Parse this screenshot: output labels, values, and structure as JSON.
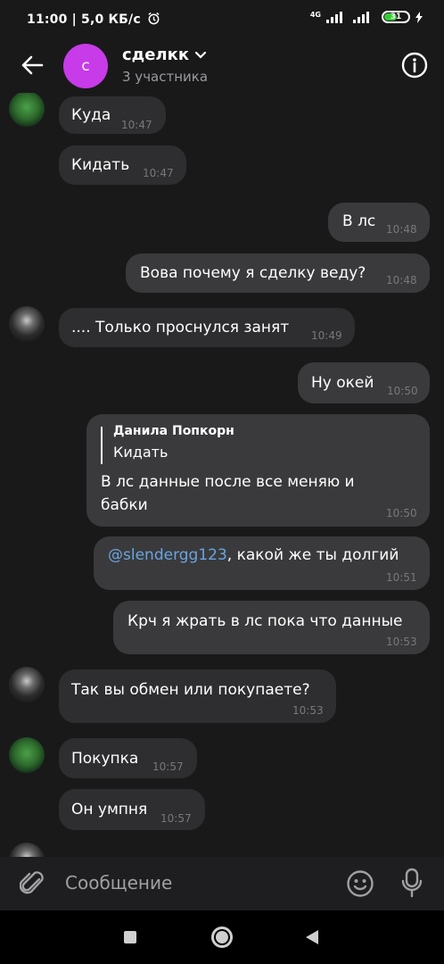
{
  "status_bar": {
    "time": "11:00",
    "speed": "5,0 КБ/с",
    "network": "4G",
    "battery": "31"
  },
  "header": {
    "avatar_letter": "с",
    "title": "сделкк",
    "subtitle": "3 участника"
  },
  "messages": [
    {
      "dir": "in",
      "text": "Куда",
      "time": "10:47",
      "avatar": "green"
    },
    {
      "dir": "in",
      "text": "Кидать",
      "time": "10:47"
    },
    {
      "dir": "out",
      "text": "В лс",
      "time": "10:48"
    },
    {
      "dir": "out",
      "text": "Вова почему я сделку веду?",
      "time": "10:48"
    },
    {
      "dir": "in",
      "text": ".... Только проснулся занят",
      "time": "10:49",
      "avatar": "dark"
    },
    {
      "dir": "out",
      "text": "Ну окей",
      "time": "10:50"
    },
    {
      "dir": "out",
      "reply_name": "Данила Попкорн",
      "reply_text": "Кидать",
      "line1": "В лс данные  после  все меняю и",
      "line2": "бабки",
      "time": "10:50"
    },
    {
      "dir": "out",
      "mention": "@slendergg123",
      "text": ",  какой же ты долгий",
      "time": "10:51"
    },
    {
      "dir": "out",
      "text": "Крч я жрать в лс пока что данные",
      "time": "10:53"
    },
    {
      "dir": "in",
      "text": "Так вы обмен или покупаете?",
      "time": "10:53",
      "avatar": "dark"
    },
    {
      "dir": "in",
      "text": "Покупка",
      "time": "10:57",
      "avatar": "green"
    },
    {
      "dir": "in",
      "text": "Он умпня",
      "time": "10:57"
    }
  ],
  "composer": {
    "placeholder": "Сообщение"
  },
  "colors": {
    "background": "#19191a",
    "bubble_in": "#2e2e30",
    "bubble_out": "#3a3a3c",
    "avatar_group": "#c83be8",
    "mention": "#6aa4e0"
  }
}
